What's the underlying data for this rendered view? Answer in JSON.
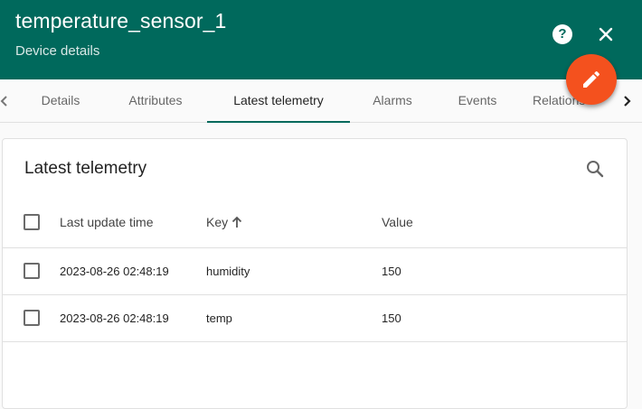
{
  "header": {
    "title": "temperature_sensor_1",
    "subtitle": "Device details",
    "help_icon": "help-circle-icon",
    "close_icon": "close-icon",
    "edit_icon": "pencil-icon",
    "fab_color": "#f4511e",
    "bg_color": "#00695c"
  },
  "tabs": [
    {
      "label": "Details",
      "active": false
    },
    {
      "label": "Attributes",
      "active": false
    },
    {
      "label": "Latest telemetry",
      "active": true
    },
    {
      "label": "Alarms",
      "active": false
    },
    {
      "label": "Events",
      "active": false
    },
    {
      "label": "Relations",
      "active": false
    }
  ],
  "card": {
    "title": "Latest telemetry",
    "search_icon": "search-icon"
  },
  "table": {
    "columns": [
      "Last update time",
      "Key",
      "Value"
    ],
    "sort_column": "Key",
    "sort_direction": "ascending",
    "rows": [
      {
        "time": "2023-08-26 02:48:19",
        "key": "humidity",
        "value": "150"
      },
      {
        "time": "2023-08-26 02:48:19",
        "key": "temp",
        "value": "150"
      }
    ]
  }
}
